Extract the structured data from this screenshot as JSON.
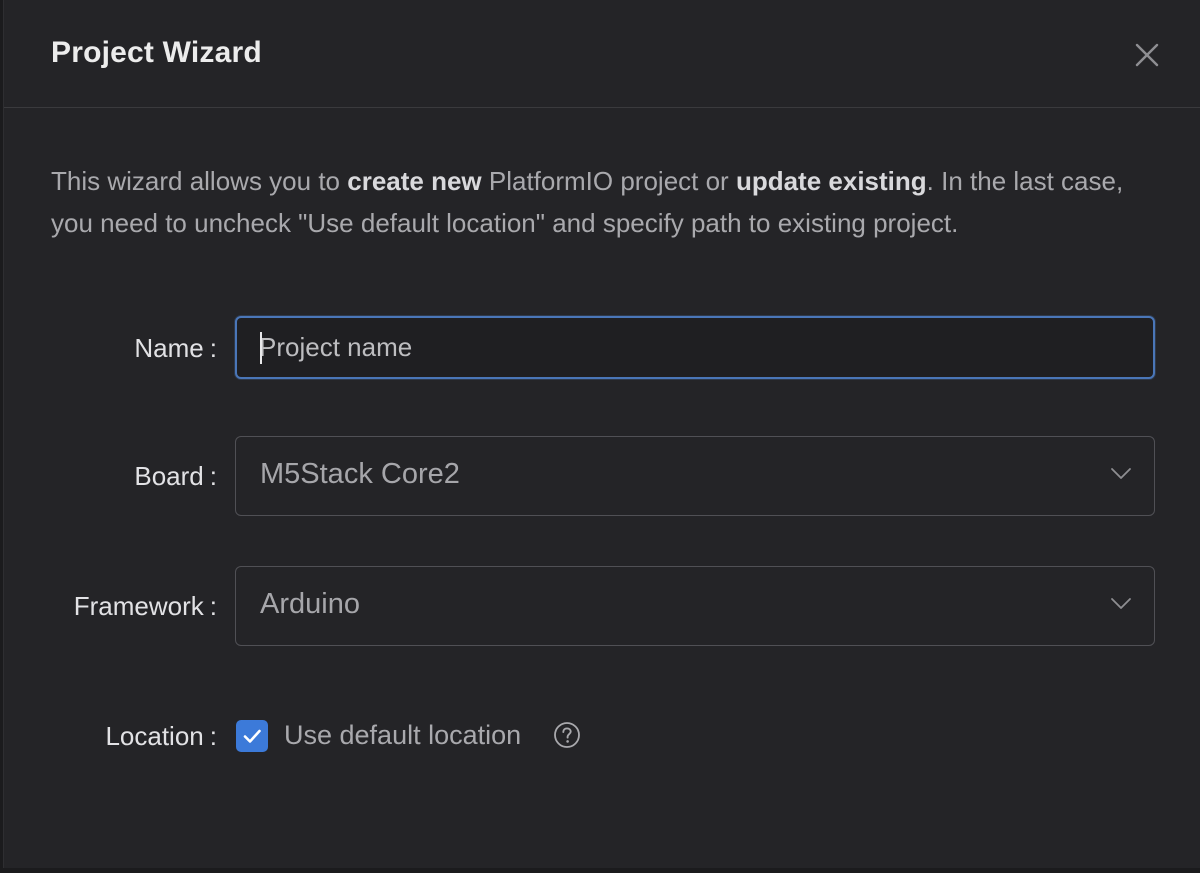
{
  "dialog": {
    "title": "Project Wizard",
    "close_icon": "close-icon"
  },
  "description": {
    "part1": "This wizard allows you to ",
    "bold1": "create new",
    "part2": " PlatformIO project or ",
    "bold2": "update existing",
    "part3": ". In the last case, you need to uncheck \"Use default location\" and specify path to existing project."
  },
  "form": {
    "name": {
      "label": "Name",
      "colon": ":",
      "placeholder": "Project name",
      "value": ""
    },
    "board": {
      "label": "Board",
      "colon": ":",
      "value": "M5Stack Core2",
      "icon": "chevron-down-icon"
    },
    "framework": {
      "label": "Framework",
      "colon": ":",
      "value": "Arduino",
      "icon": "chevron-down-icon"
    },
    "location": {
      "label": "Location",
      "colon": ":",
      "checkbox_label": "Use default location",
      "checked": true,
      "help_icon": "question-circle-icon"
    }
  },
  "colors": {
    "background": "#242427",
    "accent": "#3c7ad9",
    "focus_border": "#4a76b8"
  }
}
